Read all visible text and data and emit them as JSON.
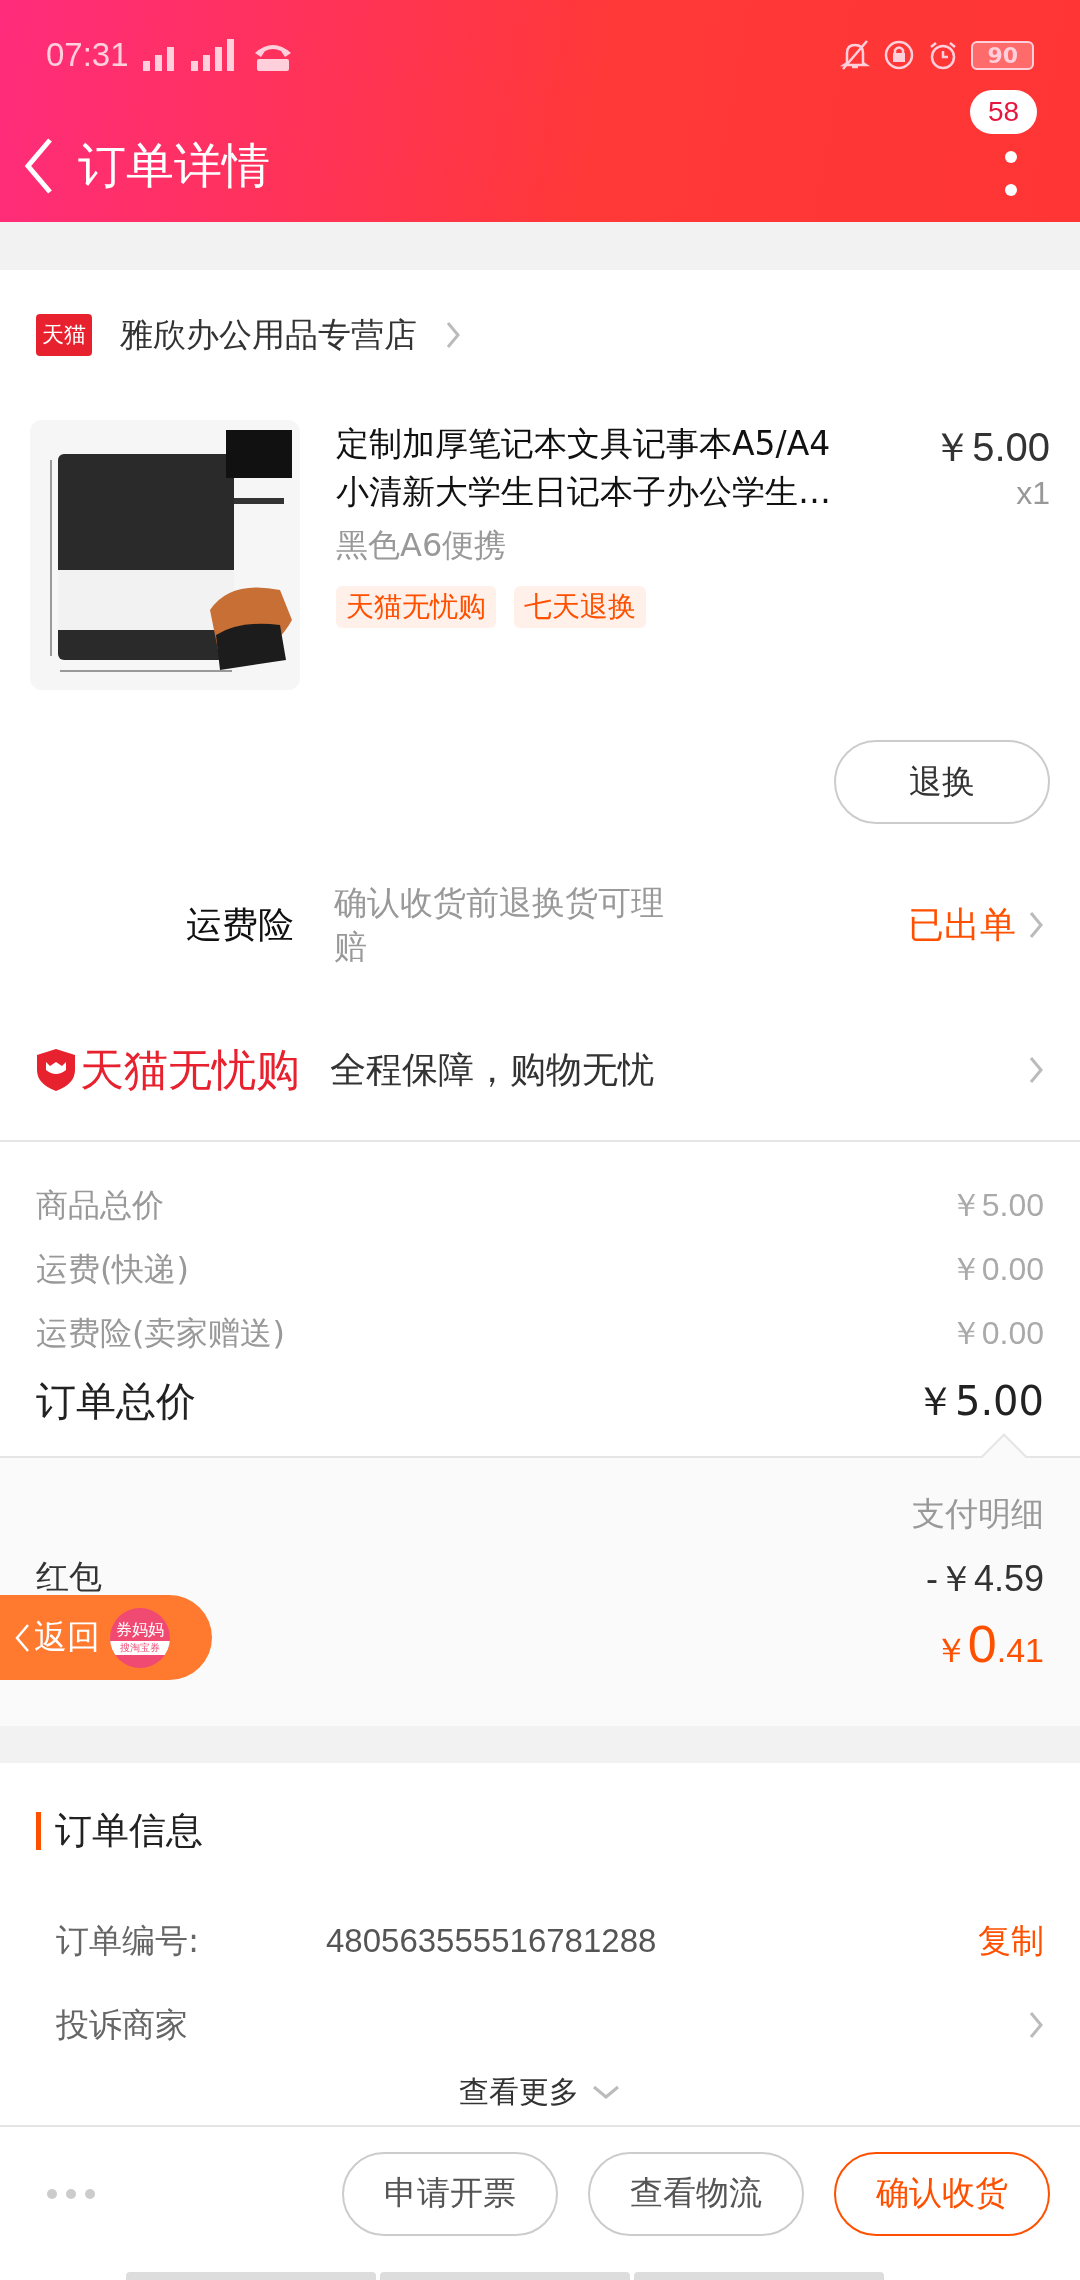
{
  "status_bar": {
    "time": "07:31",
    "battery": "90"
  },
  "header": {
    "title": "订单详情",
    "badge": "58"
  },
  "store": {
    "logo": "天猫",
    "name": "雅欣办公用品专营店"
  },
  "product": {
    "title": "定制加厚笔记本文具记事本A5/A4\n小清新大学生日记本子办公学生…",
    "price": "￥5.00",
    "quantity": "x1",
    "variant": "黑色A6便携",
    "tags": [
      "天猫无忧购",
      "七天退换"
    ],
    "action": "退换"
  },
  "insurance": {
    "label": "运费险",
    "description": "确认收货前退换货可理赔",
    "status": "已出单"
  },
  "guarantee": {
    "brand": "天猫无忧购",
    "text": "全程保障，购物无忧"
  },
  "costs": [
    {
      "label": "商品总价",
      "value": "￥5.00"
    },
    {
      "label": "运费(快递)",
      "value": "￥0.00"
    },
    {
      "label": "运费险(卖家赠送)",
      "value": "￥0.00"
    }
  ],
  "total": {
    "label": "订单总价",
    "value": "￥5.00"
  },
  "payment": {
    "link": "支付明细",
    "rows": [
      {
        "label": "红包",
        "value": "-￥4.59"
      }
    ],
    "paid": {
      "currency": "￥",
      "integer": "0",
      "decimal": ".41"
    }
  },
  "float_back": {
    "label": "返回",
    "badge_top": "券妈妈",
    "badge_bottom": "搜淘宝券"
  },
  "order_info": {
    "title": "订单信息",
    "number_label": "订单编号:",
    "number": "480563555516781288",
    "copy": "复制",
    "complaint": "投诉商家",
    "more": "查看更多"
  },
  "bottom_bar": {
    "buttons": [
      {
        "label": "申请开票",
        "kind": "outline"
      },
      {
        "label": "查看物流",
        "kind": "outline"
      },
      {
        "label": "确认收货",
        "kind": "primary"
      }
    ]
  }
}
